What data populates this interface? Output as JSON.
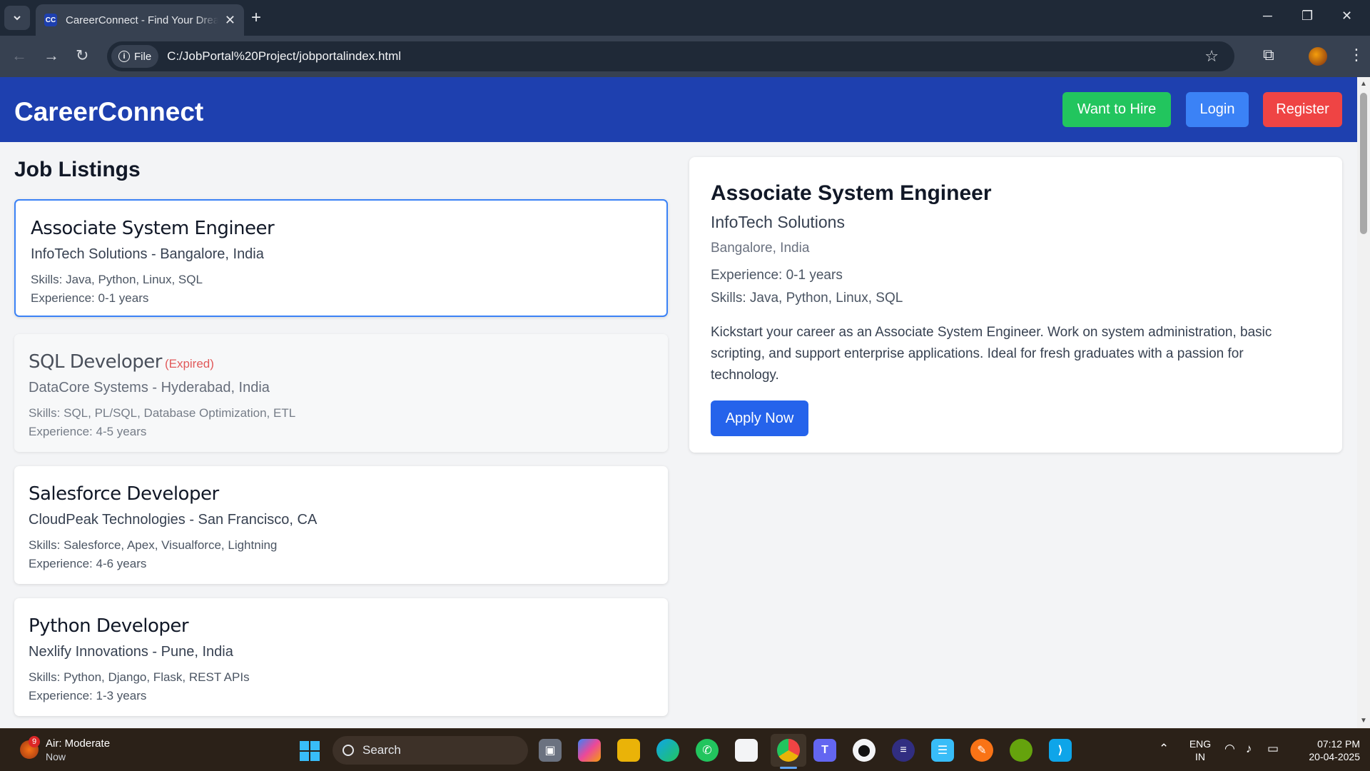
{
  "browser": {
    "tab_title": "CareerConnect - Find Your Dream Job",
    "tab_favicon": "CC",
    "address_chip": "File",
    "url": "C:/JobPortal%20Project/jobportalindex.html"
  },
  "header": {
    "brand": "CareerConnect",
    "hire_label": "Want to Hire",
    "login_label": "Login",
    "register_label": "Register",
    "colors": {
      "bg": "#1e40af",
      "hire": "#22c55e",
      "login": "#3b82f6",
      "register": "#ef4444"
    }
  },
  "listings": {
    "title": "Job Listings",
    "jobs": [
      {
        "title": "Associate System Engineer",
        "company_location": "InfoTech Solutions - Bangalore, India",
        "skills": "Skills: Java, Python, Linux, SQL",
        "experience": "Experience: 0-1 years",
        "status": ""
      },
      {
        "title": "SQL Developer",
        "company_location": "DataCore Systems - Hyderabad, India",
        "skills": "Skills: SQL, PL/SQL, Database Optimization, ETL",
        "experience": "Experience: 4-5 years",
        "status": "(Expired)"
      },
      {
        "title": "Salesforce Developer",
        "company_location": "CloudPeak Technologies - San Francisco, CA",
        "skills": "Skills: Salesforce, Apex, Visualforce, Lightning",
        "experience": "Experience: 4-6 years",
        "status": ""
      },
      {
        "title": "Python Developer",
        "company_location": "Nexlify Innovations - Pune, India",
        "skills": "Skills: Python, Django, Flask, REST APIs",
        "experience": "Experience: 1-3 years",
        "status": ""
      }
    ]
  },
  "details": {
    "title": "Associate System Engineer",
    "company": "InfoTech Solutions",
    "location": "Bangalore, India",
    "experience": "Experience: 0-1 years",
    "skills": "Skills: Java, Python, Linux, SQL",
    "description": "Kickstart your career as an Associate System Engineer. Work on system administration, basic scripting, and support enterprise applications. Ideal for fresh graduates with a passion for technology.",
    "apply_label": "Apply Now"
  },
  "taskbar": {
    "weather_badge": "9",
    "weather_title": "Air: Moderate",
    "weather_sub": "Now",
    "search_label": "Search",
    "lang_line1": "ENG",
    "lang_line2": "IN",
    "time": "07:12 PM",
    "date": "20-04-2025",
    "apps": [
      "task-view-icon",
      "copilot-icon",
      "file-explorer-icon",
      "edge-icon",
      "whatsapp-icon",
      "store-icon",
      "chrome-icon",
      "teams-icon",
      "github-icon",
      "eclipse-icon",
      "notepad-icon",
      "postman-icon",
      "spring-icon",
      "vscode-icon"
    ]
  }
}
